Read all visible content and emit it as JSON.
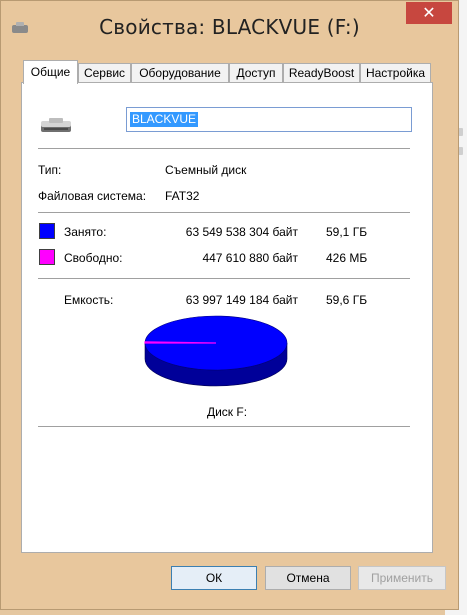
{
  "window": {
    "title": "Свойства: BLACKVUE (F:)",
    "close_glyph": "✕"
  },
  "tabs": [
    {
      "label": "Общие",
      "active": true
    },
    {
      "label": "Сервис",
      "active": false
    },
    {
      "label": "Оборудование",
      "active": false
    },
    {
      "label": "Доступ",
      "active": false
    },
    {
      "label": "ReadyBoost",
      "active": false
    },
    {
      "label": "Настройка",
      "active": false
    }
  ],
  "general": {
    "volume_name": "BLACKVUE",
    "type_label": "Тип:",
    "type_value": "Съемный диск",
    "fs_label": "Файловая система:",
    "fs_value": "FAT32",
    "used_label": "Занято:",
    "used_bytes": "63 549 538 304 байт",
    "used_size": "59,1 ГБ",
    "free_label": "Свободно:",
    "free_bytes": "447 610 880 байт",
    "free_size": "426 МБ",
    "capacity_label": "Емкость:",
    "capacity_bytes": "63 997 149 184 байт",
    "capacity_size": "59,6 ГБ",
    "disk_label": "Диск F:",
    "used_fraction": 0.993,
    "free_fraction": 0.007
  },
  "colors": {
    "used": "#0000ff",
    "free": "#ff00ff"
  },
  "buttons": {
    "ok": "ОК",
    "cancel": "Отмена",
    "apply": "Применить"
  }
}
